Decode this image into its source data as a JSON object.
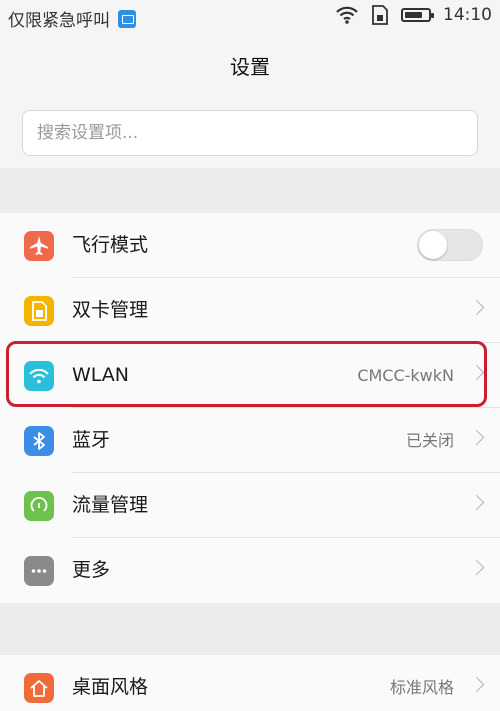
{
  "status_bar": {
    "carrier": "仅限紧急呼叫",
    "time": "14:10",
    "battery_level_fraction": 0.75,
    "icons": [
      "image-notification-icon",
      "wifi-icon",
      "sim-card-icon",
      "battery-icon"
    ]
  },
  "header": {
    "title": "设置"
  },
  "search": {
    "placeholder": "搜索设置项..."
  },
  "settings": [
    {
      "key": "airplane",
      "label": "飞行模式",
      "icon": "airplane-icon",
      "color": "#ef6a4d",
      "control": "toggle",
      "toggle_on": false
    },
    {
      "key": "dual_sim",
      "label": "双卡管理",
      "icon": "sim-card-icon",
      "color": "#f5b400",
      "control": "chevron"
    },
    {
      "key": "wlan",
      "label": "WLAN",
      "value": "CMCC-kwkN",
      "icon": "wifi-icon",
      "color": "#2bc0d9",
      "control": "chevron",
      "highlighted": true
    },
    {
      "key": "bluetooth",
      "label": "蓝牙",
      "value": "已关闭",
      "icon": "bluetooth-icon",
      "color": "#3b8de6",
      "control": "chevron"
    },
    {
      "key": "data_usage",
      "label": "流量管理",
      "icon": "data-usage-icon",
      "color": "#6cc24a",
      "control": "chevron"
    },
    {
      "key": "more",
      "label": "更多",
      "icon": "more-icon",
      "color": "#8a8a8a",
      "control": "chevron"
    },
    {
      "key": "home_style",
      "label": "桌面风格",
      "value": "标准风格",
      "icon": "home-icon",
      "color": "#f06a3a",
      "control": "chevron"
    }
  ],
  "colors": {
    "highlight_border": "#c8202c",
    "background": "#f5f5f5",
    "row_background": "#fafafa"
  }
}
